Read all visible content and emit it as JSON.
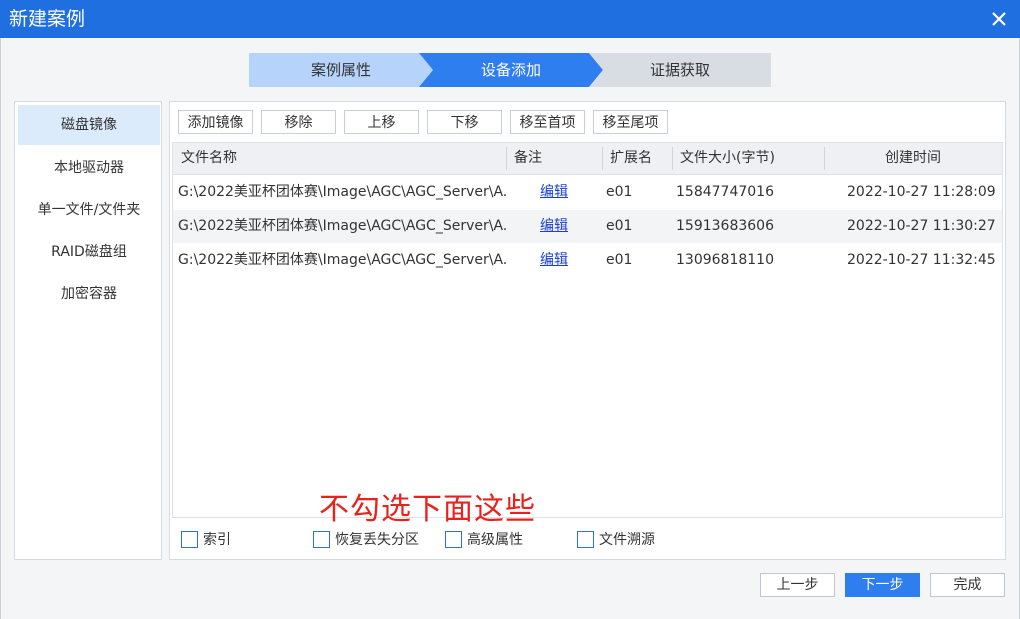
{
  "window": {
    "title": "新建案例"
  },
  "steps": [
    {
      "label": "案例属性"
    },
    {
      "label": "设备添加"
    },
    {
      "label": "证据获取"
    }
  ],
  "sidebar": {
    "items": [
      {
        "label": "磁盘镜像",
        "active": true
      },
      {
        "label": "本地驱动器"
      },
      {
        "label": "单一文件/文件夹"
      },
      {
        "label": "RAID磁盘组"
      },
      {
        "label": "加密容器"
      }
    ]
  },
  "toolbar": {
    "add_image": "添加镜像",
    "remove": "移除",
    "move_up": "上移",
    "move_down": "下移",
    "move_top": "移至首项",
    "move_bottom": "移至尾项"
  },
  "table": {
    "columns": [
      "文件名称",
      "备注",
      "扩展名",
      "文件大小(字节)",
      "创建时间"
    ],
    "rows": [
      {
        "name": "G:\\2022美亚杯团体赛\\Image\\AGC\\AGC_Server\\A...",
        "note": "编辑",
        "ext": "e01",
        "size": "15847747016",
        "created": "2022-10-27 11:28:09"
      },
      {
        "name": "G:\\2022美亚杯团体赛\\Image\\AGC\\AGC_Server\\A...",
        "note": "编辑",
        "ext": "e01",
        "size": "15913683606",
        "created": "2022-10-27 11:30:27"
      },
      {
        "name": "G:\\2022美亚杯团体赛\\Image\\AGC\\AGC_Server\\A...",
        "note": "编辑",
        "ext": "e01",
        "size": "13096818110",
        "created": "2022-10-27 11:32:45"
      }
    ]
  },
  "annotation": "不勾选下面这些",
  "options": [
    {
      "label": "索引",
      "checked": false
    },
    {
      "label": "恢复丢失分区",
      "checked": false
    },
    {
      "label": "高级属性",
      "checked": false
    },
    {
      "label": "文件溯源",
      "checked": false
    }
  ],
  "footer": {
    "prev": "上一步",
    "next": "下一步",
    "finish": "完成"
  },
  "colors": {
    "titlebar": "#1f6fe0",
    "step_active": "#2e7ef0",
    "step_done": "#b6d4fb",
    "annotation": "#e8221c"
  }
}
